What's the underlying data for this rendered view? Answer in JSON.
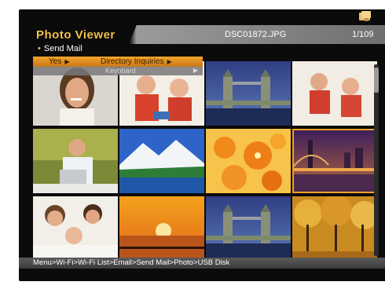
{
  "header": {
    "title": "Photo Viewer",
    "filename": "DSC01872.JPG",
    "counter": "1/109",
    "device_icon": "usb-storage-icon"
  },
  "submenu": {
    "label": "Send Mail"
  },
  "popup": {
    "option_yes": "Yes",
    "option_directory": "Directory Inquiries",
    "option_keyboard": "Keyboard"
  },
  "grid": {
    "tiles": [
      {
        "name": "woman-smiling-photo"
      },
      {
        "name": "kids-playing-photo"
      },
      {
        "name": "tower-bridge-photo"
      },
      {
        "name": "kids-sitting-photo"
      },
      {
        "name": "man-phone-laptop-photo"
      },
      {
        "name": "mountain-lake-photo"
      },
      {
        "name": "orange-flowers-photo"
      },
      {
        "name": "city-bridge-night-photo"
      },
      {
        "name": "family-photo"
      },
      {
        "name": "sunset-sea-photo"
      },
      {
        "name": "tower-bridge-photo-2"
      },
      {
        "name": "autumn-trees-photo"
      }
    ],
    "selected_index": 7
  },
  "breadcrumb": {
    "path": "Menu>Wi-Fi>Wi-Fi List>Email>Send Mail>Photo>USB Disk"
  },
  "colors": {
    "accent": "#f2c14a",
    "selection": "#f0a020",
    "background": "#0b0b0b"
  }
}
